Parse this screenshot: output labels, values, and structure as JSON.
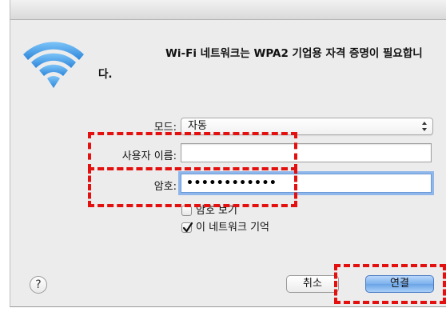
{
  "dialog": {
    "message": "Wi-Fi 네트워크는 WPA2 기업용 자격 증명이 필요합니다."
  },
  "form": {
    "mode_label": "모드:",
    "mode_value": "자동",
    "username_label": "사용자 이름:",
    "username_value": "",
    "password_label": "암호:",
    "password_masked": "••••••••••••",
    "show_password_label": "암호 보기",
    "show_password_checked": false,
    "remember_label": "이 네트워크 기억",
    "remember_checked": true
  },
  "buttons": {
    "help_label": "?",
    "cancel_label": "취소",
    "connect_label": "연결"
  },
  "icons": {
    "wifi": "wifi-icon",
    "help": "question-icon",
    "select_arrows": "up-down-arrows-icon",
    "checkmark": "checkmark-icon"
  },
  "colors": {
    "annotation": "#e3100f",
    "wifi_blue": "#3d9be9",
    "default_button": "#6aa3e6"
  }
}
